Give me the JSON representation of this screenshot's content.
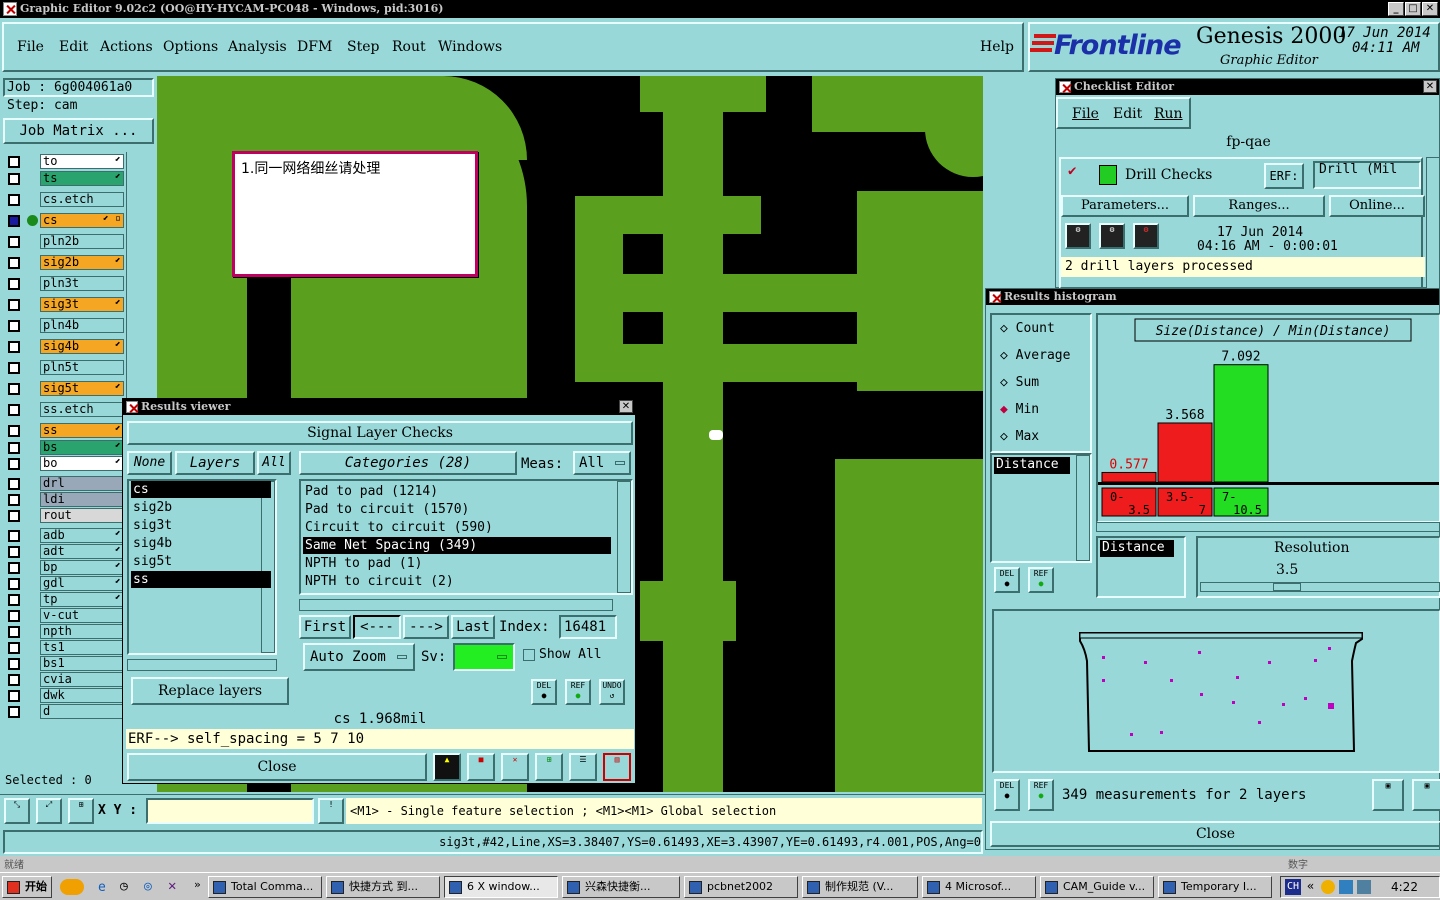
{
  "window": {
    "title": "Graphic Editor 9.02c2 (OO@HY-HYCAM-PC048 - Windows, pid:3016)",
    "min_label": "_",
    "max_label": "□",
    "close_label": "✕"
  },
  "menu": [
    "File",
    "Edit",
    "Actions",
    "Options",
    "Analysis",
    "DFM",
    "Step",
    "Rout",
    "Windows"
  ],
  "help": "Help",
  "brand": {
    "logo": "Frontline",
    "product": "Genesis 2000",
    "subtitle": "Graphic Editor",
    "date": "17 Jun 2014",
    "time": "04:11 AM"
  },
  "job": {
    "job_label": "Job  :  6g004061a0",
    "step_label": "Step:  cam",
    "matrix_button": "Job Matrix ..."
  },
  "layers": [
    {
      "name": "to",
      "color": "#ffffff",
      "mark": "⬋"
    },
    {
      "name": "ts",
      "color": "#2aa36e",
      "mark": "⬋"
    },
    {
      "name": "cs.etch",
      "color": "#98d8d8",
      "mark": ""
    },
    {
      "name": "cs",
      "color": "#f5a623",
      "mark": "⬋ ▫",
      "active": true
    },
    {
      "name": "pln2b",
      "color": "#98d8d8",
      "mark": ""
    },
    {
      "name": "sig2b",
      "color": "#f5a623",
      "mark": "⬋"
    },
    {
      "name": "pln3t",
      "color": "#98d8d8",
      "mark": ""
    },
    {
      "name": "sig3t",
      "color": "#f5a623",
      "mark": "⬋"
    },
    {
      "name": "pln4b",
      "color": "#98d8d8",
      "mark": ""
    },
    {
      "name": "sig4b",
      "color": "#f5a623",
      "mark": "⬋"
    },
    {
      "name": "pln5t",
      "color": "#98d8d8",
      "mark": ""
    },
    {
      "name": "sig5t",
      "color": "#f5a623",
      "mark": "⬋"
    },
    {
      "name": "ss.etch",
      "color": "#98d8d8",
      "mark": ""
    },
    {
      "name": "ss",
      "color": "#f5a623",
      "mark": "⬋"
    },
    {
      "name": "bs",
      "color": "#2aa36e",
      "mark": "⬋"
    },
    {
      "name": "bo",
      "color": "#ffffff",
      "mark": "⬋"
    },
    {
      "name": "drl",
      "color": "#98a8b8",
      "mark": ""
    },
    {
      "name": "ldi",
      "color": "#98a8b8",
      "mark": ""
    },
    {
      "name": "rout",
      "color": "#d8d8d8",
      "mark": ""
    },
    {
      "name": "adb",
      "color": "#98d8d8",
      "mark": "⬋"
    },
    {
      "name": "adt",
      "color": "#98d8d8",
      "mark": "⬋"
    },
    {
      "name": "bp",
      "color": "#98d8d8",
      "mark": "⬋"
    },
    {
      "name": "gdl",
      "color": "#98d8d8",
      "mark": "⬋"
    },
    {
      "name": "tp",
      "color": "#98d8d8",
      "mark": "⬋"
    },
    {
      "name": "v-cut",
      "color": "#98d8d8",
      "mark": ""
    },
    {
      "name": "npth",
      "color": "#98d8d8",
      "mark": ""
    },
    {
      "name": "ts1",
      "color": "#98d8d8",
      "mark": ""
    },
    {
      "name": "bs1",
      "color": "#98d8d8",
      "mark": ""
    },
    {
      "name": "cvia",
      "color": "#98d8d8",
      "mark": ""
    },
    {
      "name": "dwk",
      "color": "#98d8d8",
      "mark": ""
    },
    {
      "name": "d",
      "color": "#98d8d8",
      "mark": ""
    }
  ],
  "selected_label": "Selected : 0",
  "note": "1.同一网络细丝请处理",
  "results_viewer": {
    "title": "Results viewer",
    "header": "Signal Layer Checks",
    "btn_none": "None",
    "btn_layers": "Layers",
    "btn_all": "All",
    "categories_label": "Categories (28)",
    "meas_label": "Meas:",
    "meas_value": "All",
    "layers": [
      "cs",
      "sig2b",
      "sig3t",
      "sig4b",
      "sig5t",
      "ss"
    ],
    "selected_layers": [
      "cs",
      "ss"
    ],
    "categories": [
      "Pad to pad (1214)",
      "Pad to circuit (1570)",
      "Circuit to circuit (590)",
      "Same Net Spacing (349)",
      "NPTH to pad (1)",
      "NPTH to circuit (2)"
    ],
    "selected_category": "Same Net Spacing (349)",
    "first": "First",
    "prev": "<---",
    "next": "--->",
    "last": "Last",
    "index_label": "Index:",
    "index_value": "16481",
    "auto_zoom": "Auto Zoom",
    "sv_label": "Sv:",
    "show_all": "Show All",
    "replace_layers": "Replace layers",
    "measure": "cs 1.968mil",
    "erf": "ERF--> self_spacing = 5 7 10",
    "close": "Close",
    "del": "DEL",
    "ref": "REF",
    "undo": "UNDO"
  },
  "checklist": {
    "title": "Checklist Editor",
    "menu": [
      "File",
      "Edit",
      "Run"
    ],
    "name": "fp-qae",
    "check_name": "Drill Checks",
    "erf_label": "ERF:",
    "erf_value": "Drill (Mil",
    "parameters": "Parameters...",
    "ranges": "Ranges...",
    "online": "Online...",
    "date": "17 Jun 2014",
    "time": "04:16 AM - 0:00:01",
    "status": "2 drill layers processed"
  },
  "histogram": {
    "title": "Results histogram",
    "options": [
      "Count",
      "Average",
      "Sum",
      "Min",
      "Max"
    ],
    "selected_option": "Min",
    "chart_title": "Size(Distance) / Min(Distance)",
    "list_item": "Distance",
    "resolution_label": "Resolution",
    "resolution_value": "3.5",
    "summary": "349 measurements for 2 layers",
    "close": "Close",
    "del": "DEL",
    "ref": "REF"
  },
  "chart_data": {
    "type": "bar",
    "title": "Size(Distance) / Min(Distance)",
    "categories": [
      "0-3.5",
      "3.5-7",
      "7-10.5"
    ],
    "values": [
      0.577,
      3.568,
      7.092
    ],
    "value_labels": [
      "0.577",
      "3.568",
      "7.092"
    ],
    "tick_top": [
      "0-",
      "3.5-",
      "7-"
    ],
    "tick_bottom": [
      "3.5",
      "7",
      "10.5"
    ],
    "colors": [
      "#ee1c1c",
      "#ee1c1c",
      "#22dd22"
    ],
    "ylim": [
      0,
      7.8
    ]
  },
  "status": {
    "xy_label": "X Y :",
    "message": "<M1> - Single feature selection ; <M1><M1> Global selection",
    "feature_info": "sig3t,#42,Line,XS=3.38407,YS=0.61493,XE=3.43907,YE=0.61493,r4.001,POS,Ang=0",
    "hidden_left": "就绪",
    "hidden_right": "数字"
  },
  "taskbar": {
    "start": "开始",
    "tasks": [
      "Total Comma...",
      "快捷方式 到...",
      "6 X window...",
      "兴森快捷衡...",
      "pcbnet2002",
      "制作规范 (V...",
      "4 Microsof...",
      "CAM_Guide v...",
      "Temporary I..."
    ],
    "ime": "CH",
    "clock": "4:22"
  }
}
